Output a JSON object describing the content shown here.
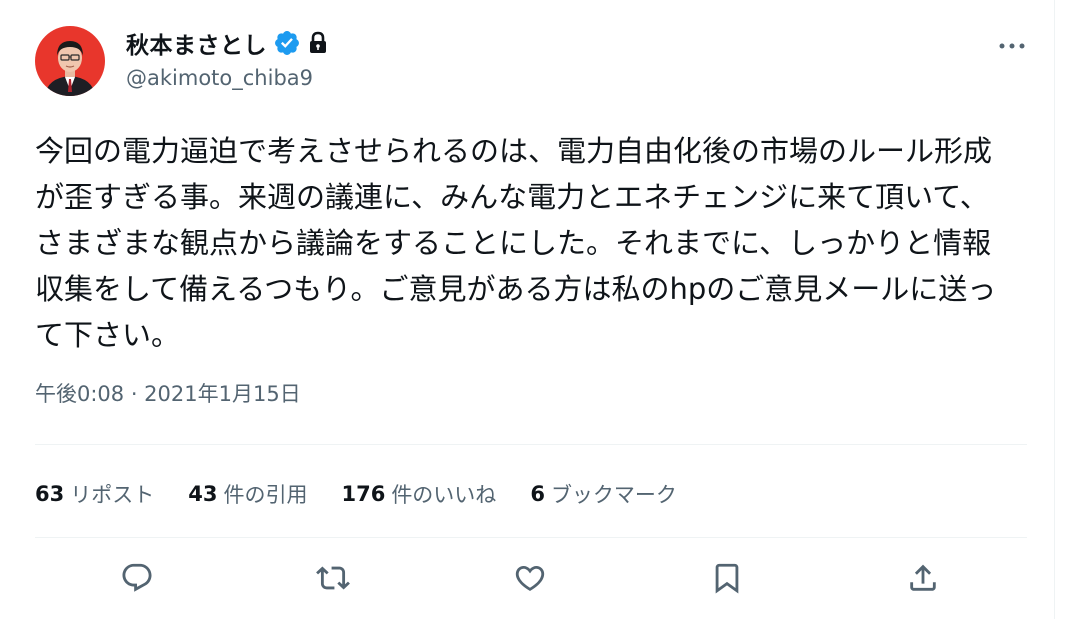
{
  "author": {
    "name": "秋本まさとし",
    "handle": "@akimoto_chiba9",
    "verified_icon": "verified-badge-icon",
    "lock_icon": "lock-icon",
    "avatar_icon": "avatar"
  },
  "tweet": {
    "lines": [
      "今回の電力逼迫で考えさせられるのは、電力自由化後の市場のルール形成",
      "が歪すぎる事。来週の議連に、みんな電力とエネチェンジに来て頂いて、",
      "さまざまな観点から議論をすることにした。それまでに、しっかりと情報",
      "収集をして備えるつもり。ご意見がある方は私のhpのご意見メールに送っ",
      "て下さい。"
    ],
    "timestamp": "午後0:08 · 2021年1月15日"
  },
  "stats": [
    {
      "count": "63",
      "label": "リポスト"
    },
    {
      "count": "43",
      "label": "件の引用"
    },
    {
      "count": "176",
      "label": "件のいいね"
    },
    {
      "count": "6",
      "label": "ブックマーク"
    }
  ],
  "actions": [
    "reply-icon",
    "retweet-icon",
    "like-icon",
    "bookmark-icon",
    "share-icon"
  ],
  "colors": {
    "verified": "#1d9bf0",
    "secondary_text": "#536471",
    "action_icon": "#536471",
    "avatar_bg": "#e8362c"
  }
}
